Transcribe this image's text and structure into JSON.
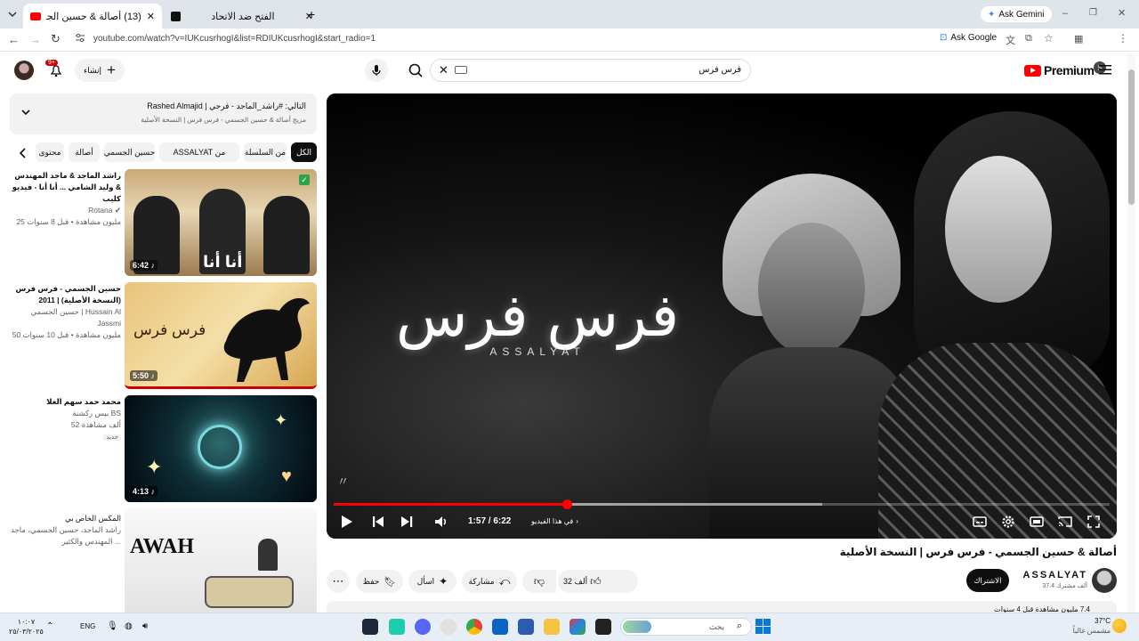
{
  "browser": {
    "tabs": [
      {
        "title": "(13) أصالة & حسين الجسمي - فر",
        "active": true
      },
      {
        "title": "الفتح ضد الاتحاد",
        "active": false
      }
    ],
    "ask_gemini": "Ask Gemini",
    "url": "youtube.com/watch?v=IUKcusrhogI&list=RDIUKcusrhogI&start_radio=1",
    "ask_google": "Ask Google",
    "profile_initial": "S"
  },
  "youtube": {
    "notification_count": "9+",
    "create_label": "إنشاء",
    "search_value": "فرس فرس",
    "logo_text": "Premium",
    "region": "SA"
  },
  "playlist": {
    "line1": "التالي: #راشد_الماجد - فرحي | Rashed Almajid",
    "line2": "مزيج أصالة & حسين الجسمي - فرس فرس | النسخة الأصلية"
  },
  "chips": [
    "الكل",
    "من السلسلة",
    "من ASSALYAT",
    "حسين الجسمي",
    "أصالة",
    "محتوى"
  ],
  "recommendations": [
    {
      "title": "راشد الماجد & ماجد المهندس & وليد الشامي ... أنا أنا - فيديو كليب",
      "channel": "Rotana",
      "stats": "25 مليون مشاهدة • قبل 8 سنوات",
      "duration": "6:42",
      "thumb_text": "أنا أنا"
    },
    {
      "title": "حسين الجسمي - فرس فرس (النسخة الأصلية) | 2011",
      "channel": "حسين الجسمي | Hussain Al Jassmi",
      "stats": "50 مليون مشاهدة • قبل 10 سنوات",
      "duration": "5:50",
      "thumb_text": "فرس فرس"
    },
    {
      "title": "محمد حمد سهم الغلا",
      "channel": "بيس ركشنة BS",
      "stats": "52 ألف مشاهدة",
      "badge": "جديد",
      "duration": "4:13",
      "thumb_text": ""
    },
    {
      "title": "المكس الخاص بي",
      "channel": "راشد الماجد، حسين الجسمي، ماجد المهندس والكثير ...",
      "stats": "",
      "duration": "",
      "thumb_text": "AWAH"
    }
  ],
  "player": {
    "art_title": "فرس فرس",
    "art_subtitle": "ASSALYAT",
    "time": "1:57 / 6:22",
    "chapter": "في هذا الفيديو",
    "progress": 0.3,
    "buffered": 0.63
  },
  "video": {
    "title": "أصالة & حسين الجسمي - فرس فرس | النسخة الأصلية",
    "channel": "ASSALYAT",
    "subscribers": "37.4 ألف مشترك",
    "subscribe_label": "الاشتراك",
    "likes": "32 ألف",
    "share_label": "مشاركة",
    "ask_label": "اسأل",
    "save_label": "حفظ",
    "views_partial": "7.4 مليون مشاهدة قبل 4 سنوات"
  },
  "taskbar": {
    "time": "١٠:٠٧",
    "date": "٢٥/٠٣/٢٠٢٥",
    "lang": "ENG",
    "search_placeholder": "بحث",
    "temp": "37°C",
    "weather": "مشمس غالباً"
  }
}
